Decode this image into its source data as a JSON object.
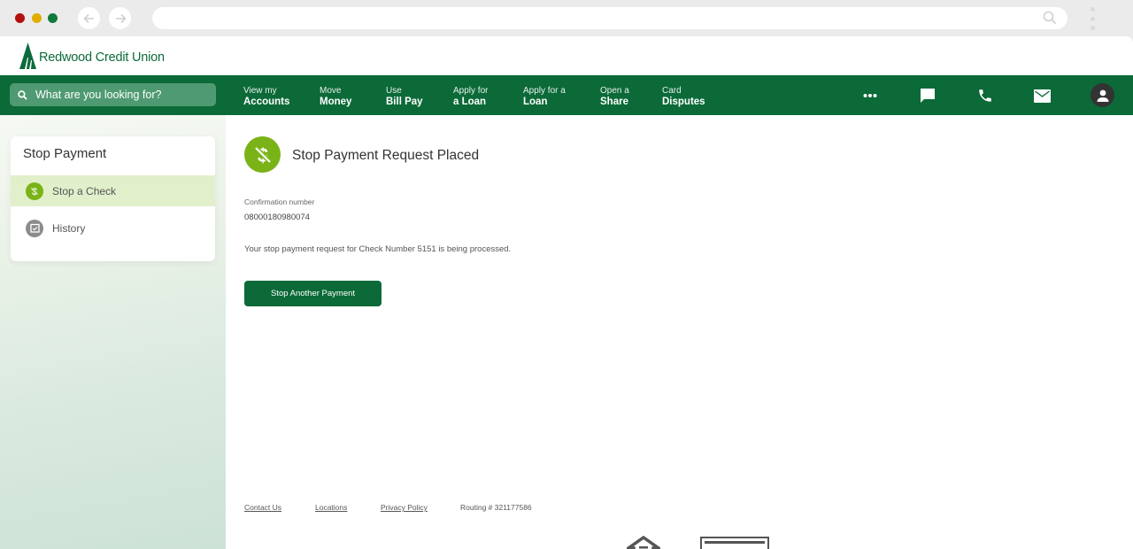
{
  "browser": {
    "back_icon": "arrow-left-icon",
    "forward_icon": "arrow-right-icon",
    "url": "",
    "search_icon": "search-icon",
    "menu_icon": "kebab-icon"
  },
  "brand": {
    "name": "Redwood Credit Union",
    "primary_color": "#0b6a38",
    "accent_color": "#7ab317"
  },
  "nav": {
    "search_placeholder": "What are you looking for?",
    "items": [
      {
        "top": "View my",
        "bottom": "Accounts"
      },
      {
        "top": "Move",
        "bottom": "Money"
      },
      {
        "top": "Use",
        "bottom": "Bill Pay"
      },
      {
        "top": "Apply for",
        "bottom": "a Loan"
      },
      {
        "top": "Apply for a",
        "bottom": "Loan"
      },
      {
        "top": "Open a",
        "bottom": "Share"
      },
      {
        "top": "Card",
        "bottom": "Disputes"
      }
    ],
    "icons": [
      "more-icon",
      "chat-icon",
      "phone-icon",
      "mail-icon",
      "profile-icon"
    ]
  },
  "sidebar": {
    "title": "Stop Payment",
    "items": [
      {
        "label": "Stop a Check",
        "icon": "stop-dollar-icon",
        "active": true
      },
      {
        "label": "History",
        "icon": "history-icon",
        "active": false
      }
    ]
  },
  "main": {
    "title": "Stop Payment Request Placed",
    "confirmation_label": "Confirmation number",
    "confirmation_value": "08000180980074",
    "message": "Your stop payment request for Check Number 5151 is being processed.",
    "button_label": "Stop Another Payment"
  },
  "footer": {
    "links": [
      "Contact Us",
      "Locations",
      "Privacy Policy"
    ],
    "routing": "Routing # 321177586"
  }
}
